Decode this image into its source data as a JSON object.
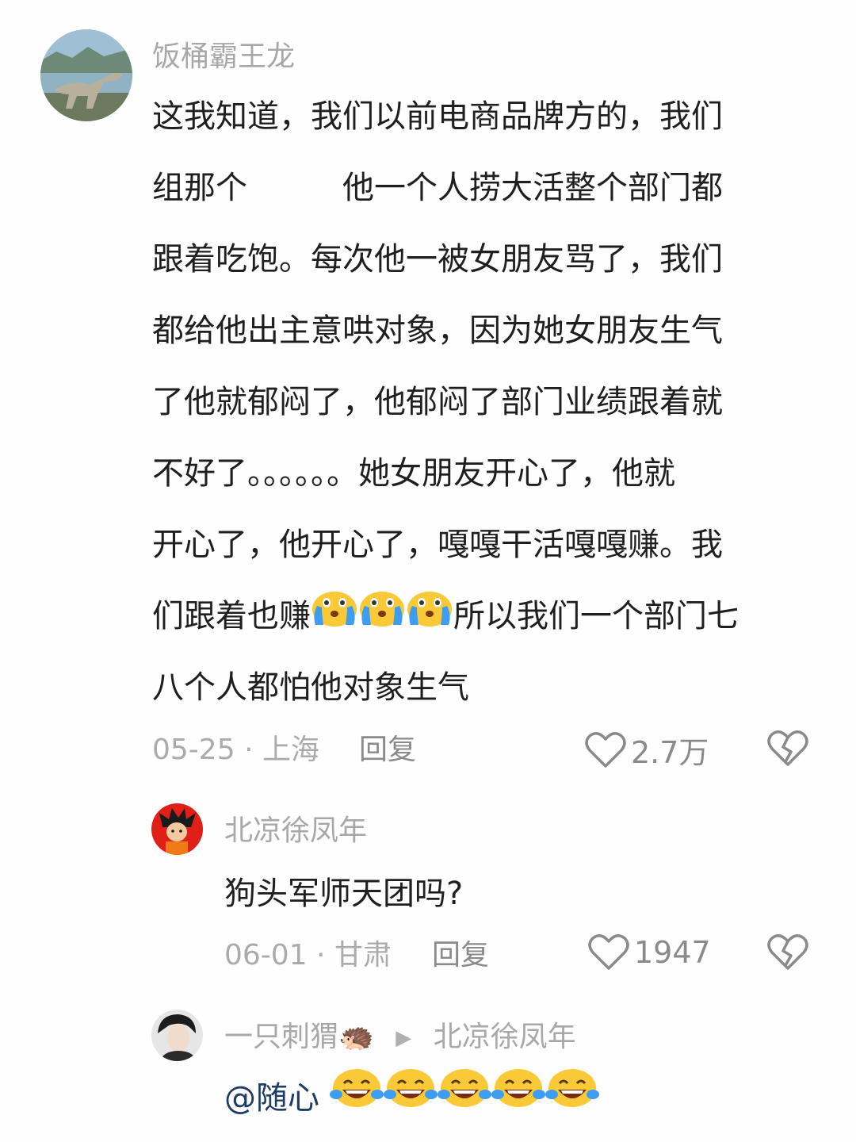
{
  "comments": [
    {
      "username": "饭桶霸王龙",
      "lines": [
        "这我知道，我们以前电商品牌方的，我们",
        "组那个　　　他一个人捞大活整个部门都",
        "跟着吃饱。每次他一被女朋友骂了，我们",
        "都给他出主意哄对象，因为她女朋友生气",
        "了他就郁闷了，他郁闷了部门业绩跟着就",
        "不好了。。。。。。她女朋友开心了，他就",
        "开心了，他开心了，嘎嘎干活嘎嘎赚。我"
      ],
      "line8_before": "们跟着也赚",
      "line8_after": "所以我们一个部门七",
      "line9": "八个人都怕他对象生气",
      "date": "05-25",
      "location": "上海",
      "reply": "回复",
      "likes": "2.7万"
    },
    {
      "username": "北凉徐凤年",
      "text": "狗头军师天团吗?",
      "date": "06-01",
      "location": "甘肃",
      "reply": "回复",
      "likes": "1947"
    },
    {
      "username": "一只刺猬🦔",
      "reply_to": "北凉徐凤年",
      "mention": "@随心"
    }
  ],
  "meta_separator": "·",
  "icons": {
    "like": "heart-outline-icon",
    "dislike": "broken-heart-icon",
    "reply_arrow": "triangle-right-icon",
    "emoji_cry": "crying-face-emoji",
    "emoji_laugh": "tears-of-joy-emoji"
  },
  "colors": {
    "background": "#fefefe",
    "text": "#1f1f1f",
    "muted": "#a8a8a8",
    "mention": "#1e3d66",
    "emoji_yellow": "#f9c937"
  }
}
